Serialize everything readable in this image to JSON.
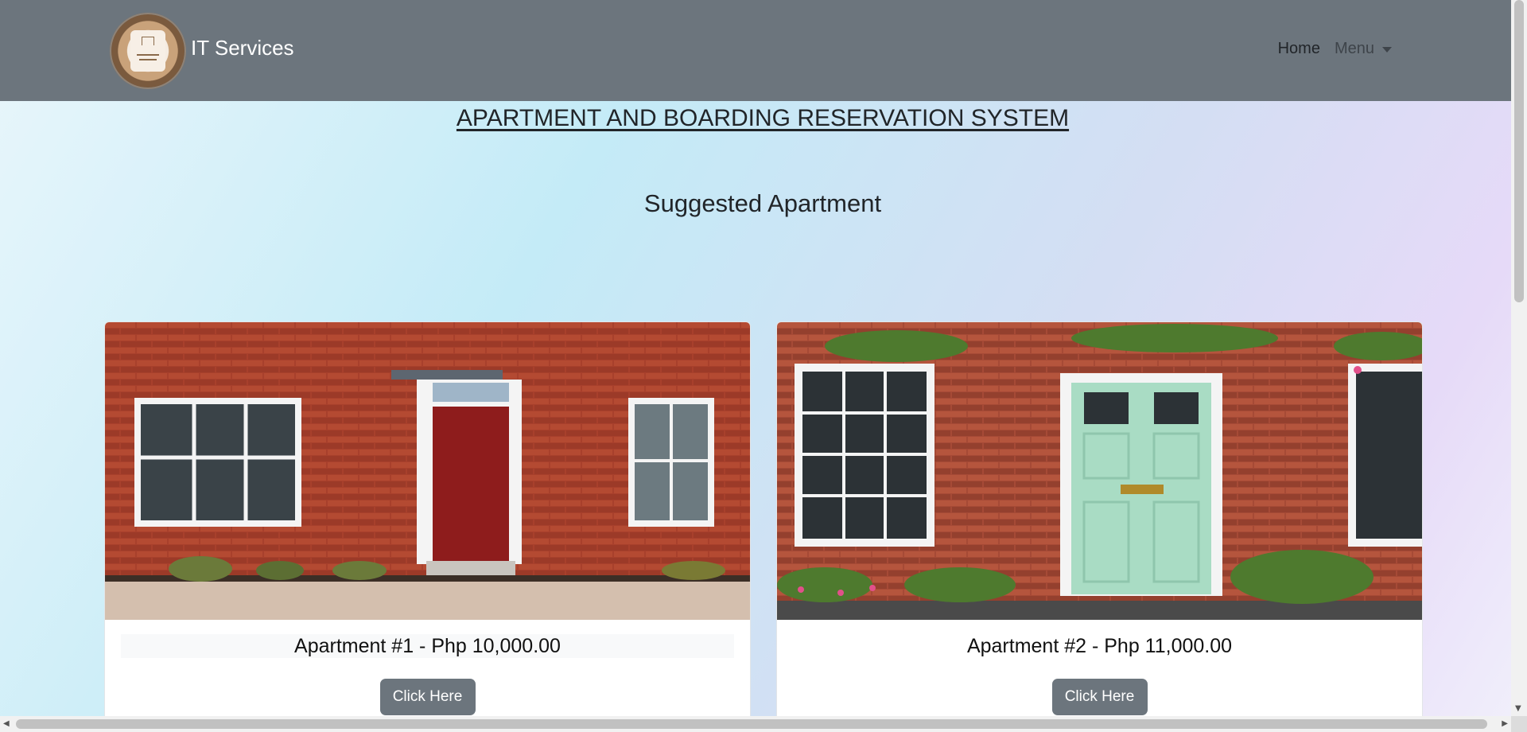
{
  "navbar": {
    "brand_text": "IT Services",
    "home_label": "Home",
    "menu_label": "Menu"
  },
  "page": {
    "title": "APARTMENT AND BOARDING RESERVATION SYSTEM",
    "section_title": "Suggested Apartment"
  },
  "cards": [
    {
      "title": "Apartment #1 - Php 10,000.00",
      "button_label": "Click Here"
    },
    {
      "title": "Apartment #2 - Php 11,000.00",
      "button_label": "Click Here"
    }
  ],
  "colors": {
    "navbar_bg": "#6c757d",
    "button_bg": "#6c757d"
  }
}
